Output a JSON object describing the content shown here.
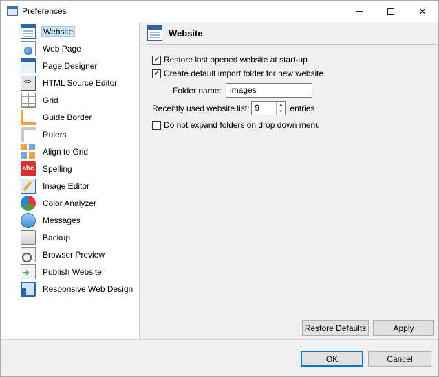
{
  "window": {
    "title": "Preferences",
    "icon": "preferences-window-icon"
  },
  "sidebar": {
    "selected_index": 0,
    "items": [
      {
        "label": "Website",
        "icon": "website-icon"
      },
      {
        "label": "Web Page",
        "icon": "web-page-icon"
      },
      {
        "label": "Page Designer",
        "icon": "page-designer-icon"
      },
      {
        "label": "HTML Source Editor",
        "icon": "html-source-icon"
      },
      {
        "label": "Grid",
        "icon": "grid-icon"
      },
      {
        "label": "Guide Border",
        "icon": "guide-border-icon"
      },
      {
        "label": "Rulers",
        "icon": "rulers-icon"
      },
      {
        "label": "Align to Grid",
        "icon": "align-to-grid-icon"
      },
      {
        "label": "Spelling",
        "icon": "spelling-icon",
        "icon_text": "abc"
      },
      {
        "label": "Image Editor",
        "icon": "image-editor-icon"
      },
      {
        "label": "Color Analyzer",
        "icon": "color-analyzer-icon"
      },
      {
        "label": "Messages",
        "icon": "messages-icon"
      },
      {
        "label": "Backup",
        "icon": "backup-icon"
      },
      {
        "label": "Browser Preview",
        "icon": "browser-preview-icon"
      },
      {
        "label": "Publish Website",
        "icon": "publish-website-icon"
      },
      {
        "label": "Responsive Web Design",
        "icon": "responsive-web-design-icon"
      }
    ]
  },
  "panel": {
    "title": "Website",
    "restore_last_site": {
      "label": "Restore last opened website at start-up",
      "checked": true
    },
    "create_import_folder": {
      "label": "Create default import folder for new website",
      "checked": true
    },
    "folder_name": {
      "label": "Folder name:",
      "value": "images"
    },
    "recent_list": {
      "label": "Recently used website list:",
      "value": "9",
      "suffix": "entries"
    },
    "no_expand_folders": {
      "label": "Do not expand folders on drop down menu",
      "checked": false
    },
    "restore_defaults_label": "Restore Defaults",
    "apply_label": "Apply"
  },
  "footer": {
    "ok_label": "OK",
    "cancel_label": "Cancel"
  },
  "colors": {
    "selection_bg": "#cce4f7",
    "default_button_border": "#0078d7"
  }
}
